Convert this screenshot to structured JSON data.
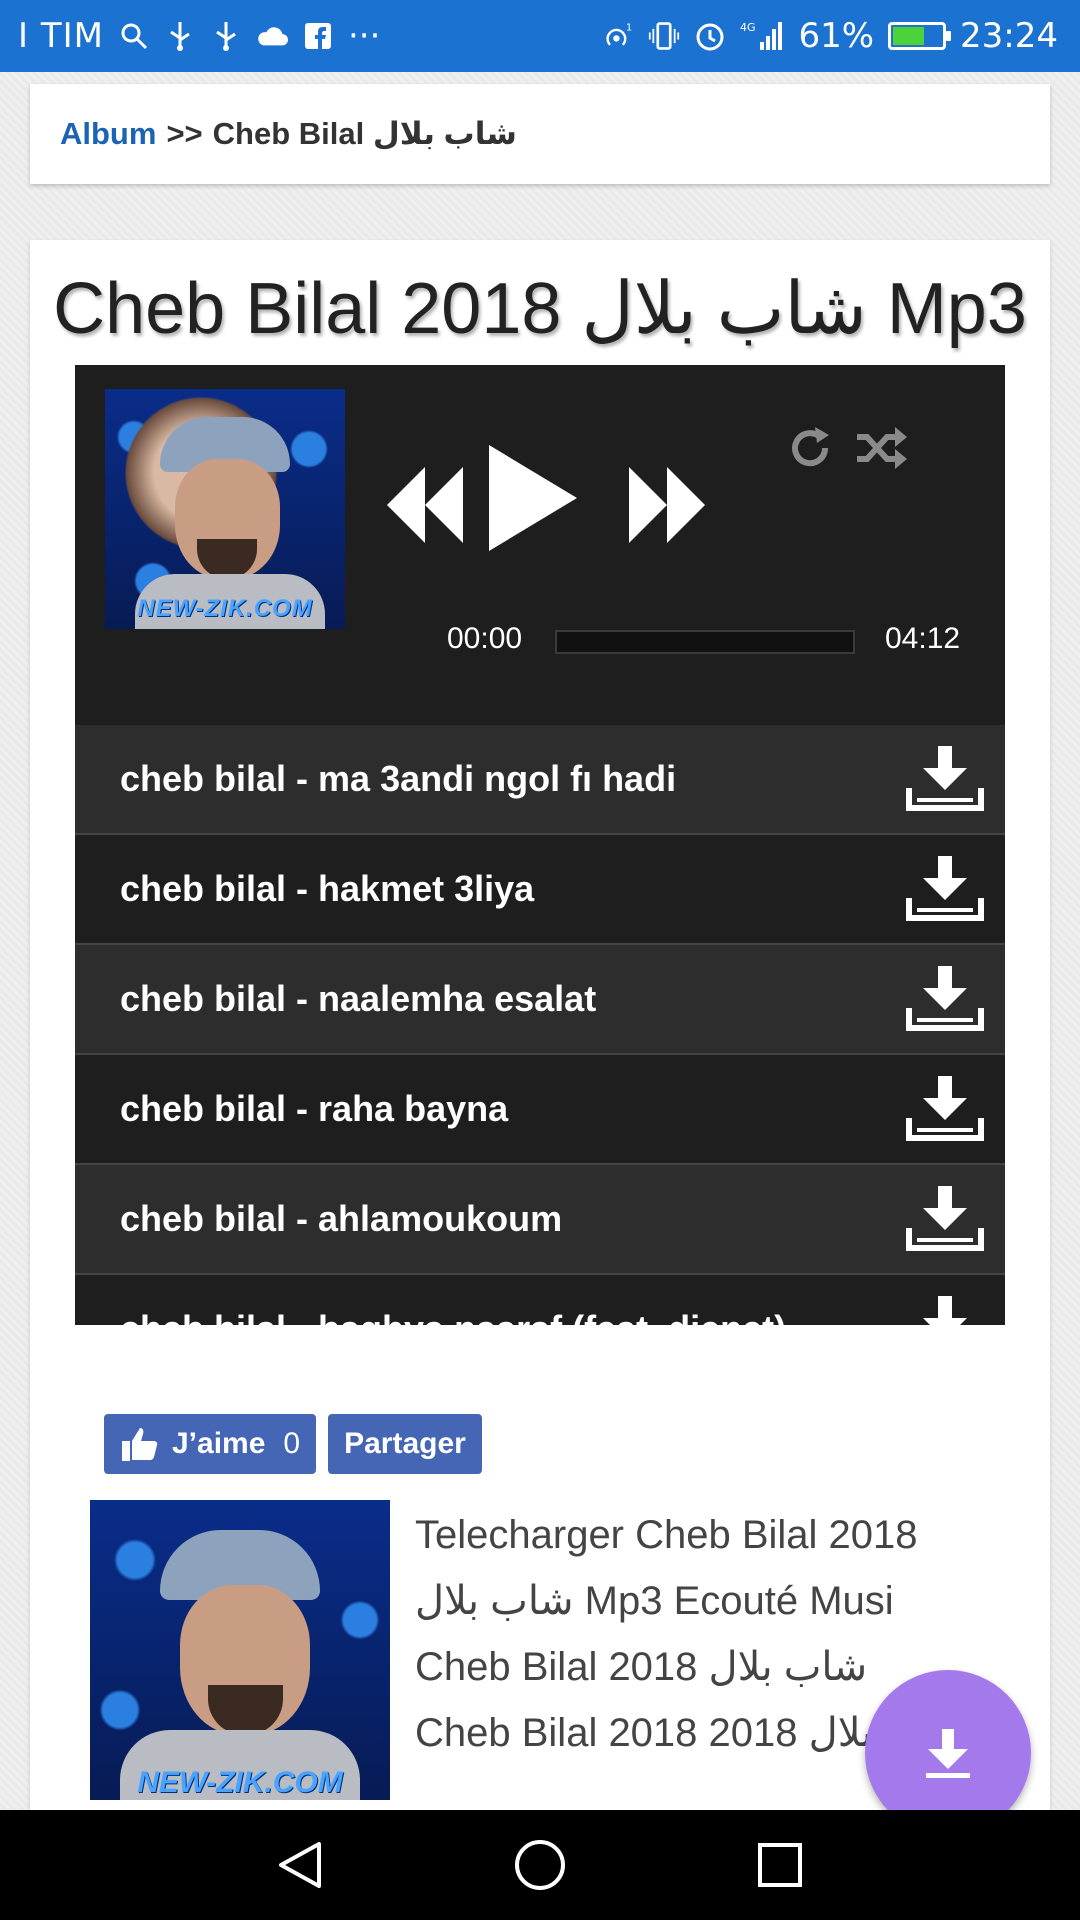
{
  "status_bar": {
    "carrier": "I TIM",
    "signal_superscript": "1",
    "network_type": "4G",
    "battery_percent": "61%",
    "battery_level": 0.61,
    "time": "23:24",
    "overflow": "···"
  },
  "breadcrumb": {
    "link": "Album",
    "separator": ">>",
    "current": "Cheb Bilal شاب بلال"
  },
  "album": {
    "title": "Cheb Bilal 2018 شاب بلال Mp3",
    "cover_watermark": "NEW-ZIK.COM"
  },
  "player": {
    "current_time": "00:00",
    "duration": "04:12",
    "progress": 0.0
  },
  "tracks": [
    {
      "title": "cheb bilal - ma 3andi ngol fı hadi"
    },
    {
      "title": "cheb bilal - hakmet 3liya"
    },
    {
      "title": "cheb bilal - naalemha esalat"
    },
    {
      "title": "cheb bilal - raha bayna"
    },
    {
      "title": "cheb bilal - ahlamoukoum"
    },
    {
      "title": "cheb bilal - baghya naaraf (feat. djenet)"
    }
  ],
  "social": {
    "like_label": "J’aime",
    "like_count": "0",
    "share_label": "Partager"
  },
  "description": {
    "lines": [
      "Telecharger Cheb Bilal 2018",
      "شاب بلال Mp3 Ecouté Musi",
      "Cheb Bilal 2018 شاب بلال",
      "Cheb Bilal 2018 2018 شاب بلال"
    ],
    "image_watermark": "NEW-ZIK.COM"
  },
  "colors": {
    "status_bar": "#1c72d0",
    "link": "#1d63b5",
    "player_bg": "#1e1e1e",
    "fab": "#a479ec",
    "fb_button": "#4466b5"
  }
}
